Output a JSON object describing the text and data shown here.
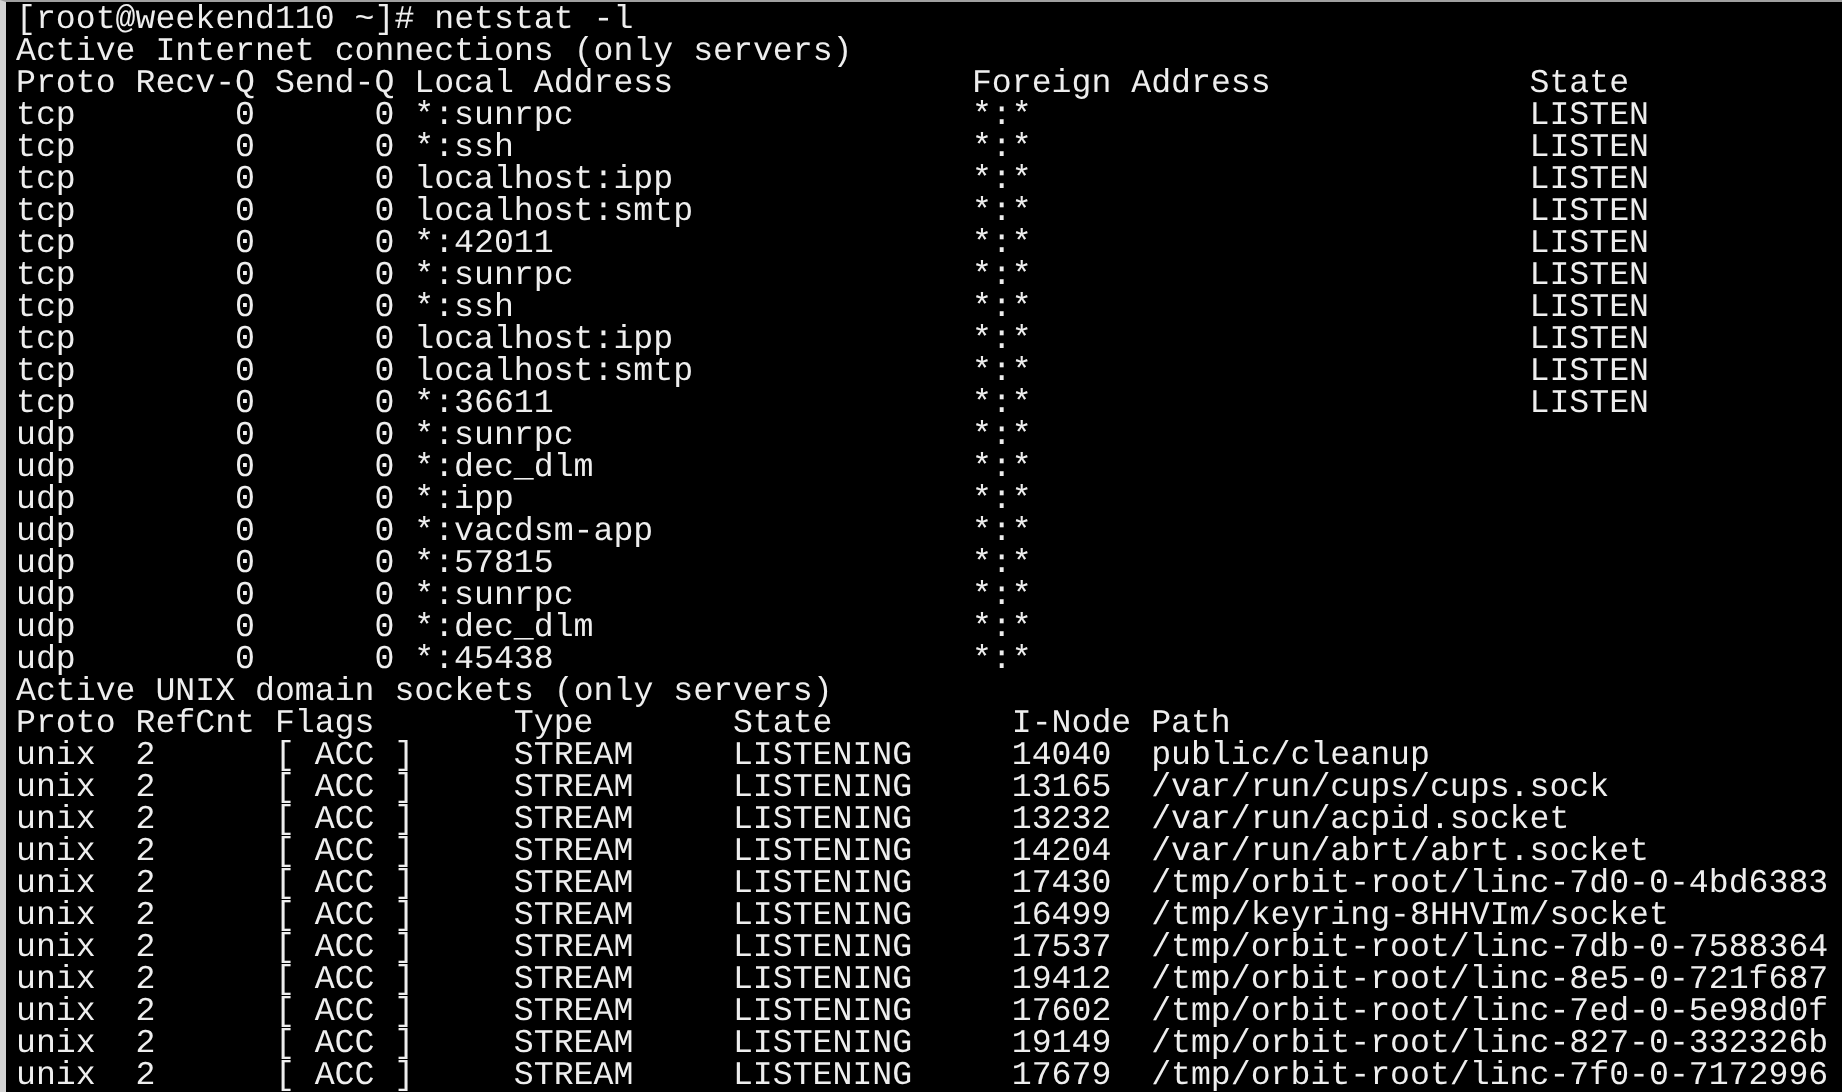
{
  "prompt": "[root@weekend110 ~]# netstat -l",
  "internet": {
    "title": "Active Internet connections (only servers)",
    "columns": [
      "Proto",
      "Recv-Q",
      "Send-Q",
      "Local Address",
      "Foreign Address",
      "State"
    ],
    "rows": [
      {
        "proto": "tcp",
        "recv_q": "0",
        "send_q": "0",
        "local_address": "*:sunrpc",
        "foreign_address": "*:*",
        "state": "LISTEN"
      },
      {
        "proto": "tcp",
        "recv_q": "0",
        "send_q": "0",
        "local_address": "*:ssh",
        "foreign_address": "*:*",
        "state": "LISTEN"
      },
      {
        "proto": "tcp",
        "recv_q": "0",
        "send_q": "0",
        "local_address": "localhost:ipp",
        "foreign_address": "*:*",
        "state": "LISTEN"
      },
      {
        "proto": "tcp",
        "recv_q": "0",
        "send_q": "0",
        "local_address": "localhost:smtp",
        "foreign_address": "*:*",
        "state": "LISTEN"
      },
      {
        "proto": "tcp",
        "recv_q": "0",
        "send_q": "0",
        "local_address": "*:42011",
        "foreign_address": "*:*",
        "state": "LISTEN"
      },
      {
        "proto": "tcp",
        "recv_q": "0",
        "send_q": "0",
        "local_address": "*:sunrpc",
        "foreign_address": "*:*",
        "state": "LISTEN"
      },
      {
        "proto": "tcp",
        "recv_q": "0",
        "send_q": "0",
        "local_address": "*:ssh",
        "foreign_address": "*:*",
        "state": "LISTEN"
      },
      {
        "proto": "tcp",
        "recv_q": "0",
        "send_q": "0",
        "local_address": "localhost:ipp",
        "foreign_address": "*:*",
        "state": "LISTEN"
      },
      {
        "proto": "tcp",
        "recv_q": "0",
        "send_q": "0",
        "local_address": "localhost:smtp",
        "foreign_address": "*:*",
        "state": "LISTEN"
      },
      {
        "proto": "tcp",
        "recv_q": "0",
        "send_q": "0",
        "local_address": "*:36611",
        "foreign_address": "*:*",
        "state": "LISTEN"
      },
      {
        "proto": "udp",
        "recv_q": "0",
        "send_q": "0",
        "local_address": "*:sunrpc",
        "foreign_address": "*:*"
      },
      {
        "proto": "udp",
        "recv_q": "0",
        "send_q": "0",
        "local_address": "*:dec_dlm",
        "foreign_address": "*:*"
      },
      {
        "proto": "udp",
        "recv_q": "0",
        "send_q": "0",
        "local_address": "*:ipp",
        "foreign_address": "*:*"
      },
      {
        "proto": "udp",
        "recv_q": "0",
        "send_q": "0",
        "local_address": "*:vacdsm-app",
        "foreign_address": "*:*"
      },
      {
        "proto": "udp",
        "recv_q": "0",
        "send_q": "0",
        "local_address": "*:57815",
        "foreign_address": "*:*"
      },
      {
        "proto": "udp",
        "recv_q": "0",
        "send_q": "0",
        "local_address": "*:sunrpc",
        "foreign_address": "*:*"
      },
      {
        "proto": "udp",
        "recv_q": "0",
        "send_q": "0",
        "local_address": "*:dec_dlm",
        "foreign_address": "*:*"
      },
      {
        "proto": "udp",
        "recv_q": "0",
        "send_q": "0",
        "local_address": "*:45438",
        "foreign_address": "*:*"
      }
    ]
  },
  "unix": {
    "title": "Active UNIX domain sockets (only servers)",
    "columns": [
      "Proto",
      "RefCnt",
      "Flags",
      "Type",
      "State",
      "I-Node",
      "Path"
    ],
    "rows": [
      {
        "proto": "unix",
        "refcnt": "2",
        "flags": "[ ACC ]",
        "type": "STREAM",
        "state": "LISTENING",
        "inode": "14040",
        "path": "public/cleanup"
      },
      {
        "proto": "unix",
        "refcnt": "2",
        "flags": "[ ACC ]",
        "type": "STREAM",
        "state": "LISTENING",
        "inode": "13165",
        "path": "/var/run/cups/cups.sock"
      },
      {
        "proto": "unix",
        "refcnt": "2",
        "flags": "[ ACC ]",
        "type": "STREAM",
        "state": "LISTENING",
        "inode": "13232",
        "path": "/var/run/acpid.socket"
      },
      {
        "proto": "unix",
        "refcnt": "2",
        "flags": "[ ACC ]",
        "type": "STREAM",
        "state": "LISTENING",
        "inode": "14204",
        "path": "/var/run/abrt/abrt.socket"
      },
      {
        "proto": "unix",
        "refcnt": "2",
        "flags": "[ ACC ]",
        "type": "STREAM",
        "state": "LISTENING",
        "inode": "17430",
        "path": "/tmp/orbit-root/linc-7d0-0-4bd6383"
      },
      {
        "proto": "unix",
        "refcnt": "2",
        "flags": "[ ACC ]",
        "type": "STREAM",
        "state": "LISTENING",
        "inode": "16499",
        "path": "/tmp/keyring-8HHVIm/socket"
      },
      {
        "proto": "unix",
        "refcnt": "2",
        "flags": "[ ACC ]",
        "type": "STREAM",
        "state": "LISTENING",
        "inode": "17537",
        "path": "/tmp/orbit-root/linc-7db-0-7588364"
      },
      {
        "proto": "unix",
        "refcnt": "2",
        "flags": "[ ACC ]",
        "type": "STREAM",
        "state": "LISTENING",
        "inode": "19412",
        "path": "/tmp/orbit-root/linc-8e5-0-721f687"
      },
      {
        "proto": "unix",
        "refcnt": "2",
        "flags": "[ ACC ]",
        "type": "STREAM",
        "state": "LISTENING",
        "inode": "17602",
        "path": "/tmp/orbit-root/linc-7ed-0-5e98d0f"
      },
      {
        "proto": "unix",
        "refcnt": "2",
        "flags": "[ ACC ]",
        "type": "STREAM",
        "state": "LISTENING",
        "inode": "19149",
        "path": "/tmp/orbit-root/linc-827-0-332326b"
      },
      {
        "proto": "unix",
        "refcnt": "2",
        "flags": "[ ACC ]",
        "type": "STREAM",
        "state": "LISTENING",
        "inode": "17679",
        "path": "/tmp/orbit-root/linc-7f0-0-7172996"
      }
    ]
  }
}
